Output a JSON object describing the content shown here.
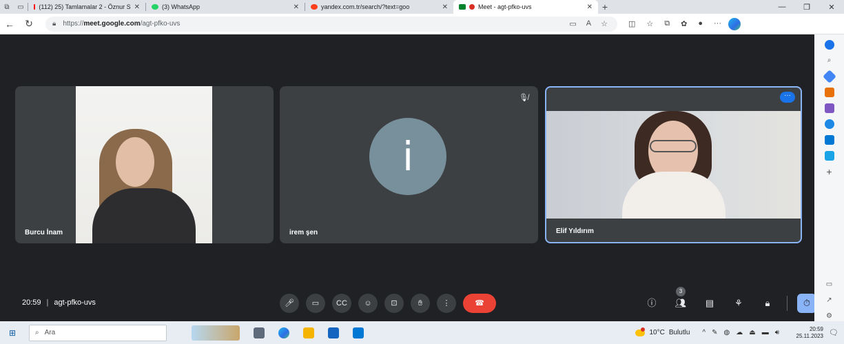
{
  "browser": {
    "tabs": [
      {
        "title": "(112) 25) Tamlamalar 2 - Öznur S",
        "fav_color": "#ff0000"
      },
      {
        "title": "(3) WhatsApp",
        "fav_color": "#25d366"
      },
      {
        "title": "yandex.com.tr/search/?text=goo",
        "fav_color": "#fc3f1d"
      },
      {
        "title": "Meet - agt-pfko-uvs",
        "fav_color": "#00832d"
      }
    ],
    "new_tab": "+",
    "url_prefix": "https://",
    "url_domain": "meet.google.com",
    "url_path": "/agt-pfko-uvs"
  },
  "meet": {
    "participants": [
      {
        "name": "Burcu İnam"
      },
      {
        "name": "irem şen",
        "avatar_letter": "i"
      },
      {
        "name": "Elif Yıldırım"
      }
    ],
    "time": "20:59",
    "meeting_code": "agt-pfko-uvs",
    "people_count": "3"
  },
  "taskbar": {
    "search_placeholder": "Ara",
    "temperature": "10°C",
    "weather_text": "Bulutlu",
    "clock_time": "20:59",
    "clock_date": "25.11.2023"
  }
}
